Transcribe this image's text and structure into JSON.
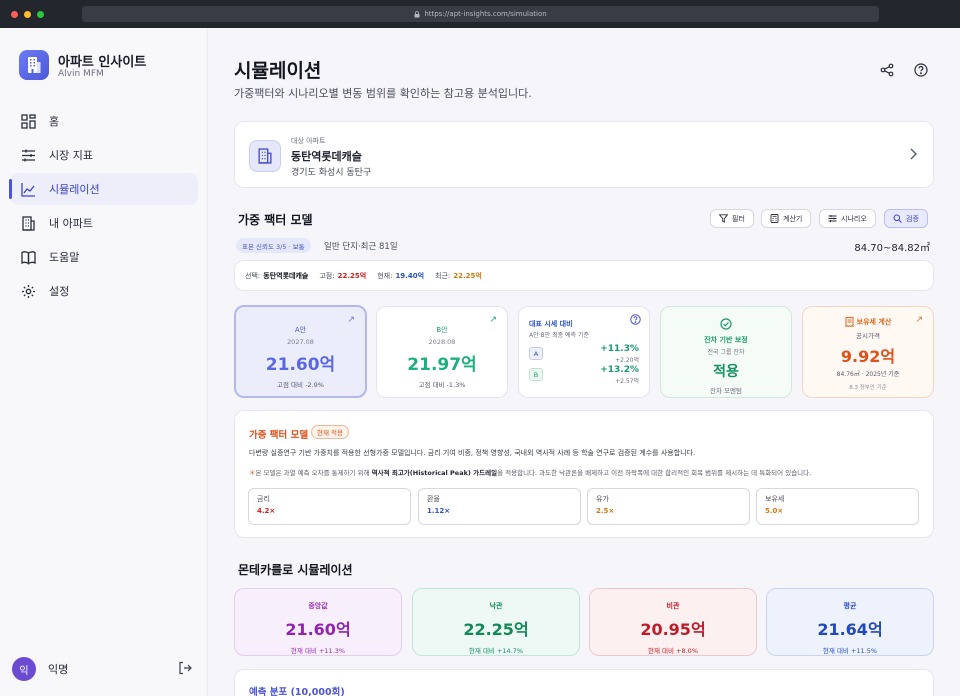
{
  "browser": {
    "url": "https://apt-insights.com/simulation"
  },
  "app": {
    "name": "아파트 인사이트",
    "user_sub": "Alvin MFM"
  },
  "nav": [
    {
      "label": "홈",
      "icon": "grid-icon"
    },
    {
      "label": "시장 지표",
      "icon": "sliders-icon"
    },
    {
      "label": "시뮬레이션",
      "icon": "chart-line-icon",
      "active": true
    },
    {
      "label": "내 아파트",
      "icon": "building-icon"
    },
    {
      "label": "도움말",
      "icon": "book-icon"
    },
    {
      "label": "설정",
      "icon": "gear-icon"
    }
  ],
  "user": {
    "initial": "익",
    "name": "익명"
  },
  "page": {
    "title": "시뮬레이션",
    "subtitle": "가중팩터와 시나리오별 변동 범위를 확인하는 참고용 분석입니다."
  },
  "target": {
    "label": "대상 아파트",
    "name": "동탄역롯데캐슬",
    "address": "경기도 화성시 동탄구"
  },
  "factor_model": {
    "title": "가중 팩터 모델",
    "buttons": [
      "필터",
      "계산기",
      "시나리오",
      "검증"
    ],
    "pill": "표본 신뢰도 3/5 · 보통",
    "desc": "일반 단지·최근 81일",
    "area": "84.70~84.82㎡",
    "sel_label": "선택:",
    "sel_name": "동탄역롯데캐슬",
    "fixed_label": "고점:",
    "fixed_value": "22.25억",
    "cur_label": "현재:",
    "cur_value": "19.40억",
    "recent_label": "최근:",
    "recent_value": "22.25억"
  },
  "scenarios": {
    "a": {
      "title": "A안",
      "date": "2027.08",
      "value": "21.60억",
      "change": "고점 대비 -2.9%"
    },
    "b": {
      "title": "B안",
      "date": "2028.08",
      "value": "21.97억",
      "change": "고점 대비 -1.3%"
    },
    "compare": {
      "title": "대표 시세 대비",
      "sub": "A안·B안 최종 예측 기준",
      "a_tag": "A",
      "a_pct": "+11.3%",
      "a_amt": "+2.20억",
      "b_tag": "B",
      "b_pct": "+13.2%",
      "b_amt": "+2.57억"
    },
    "correction": {
      "title": "잔차 기반 보정",
      "sub": "전국 그룹 잔차",
      "value": "적용",
      "note": "잔차 모멘텀"
    },
    "tax": {
      "title": "보유세 계산",
      "sub": "공시가격",
      "value": "9.92억",
      "note": "84.76㎡ · 2025년 기준",
      "foot": "8.3 정부안 기준"
    }
  },
  "model_detail": {
    "title": "가중 팩터 모델",
    "badge": "현재 적용",
    "desc": "다변량 실증연구 기반 가중치를 적용한 선형가중 모델입니다. 금리 기여 비중, 정책 영향성, 국내외 역사적 사례 등 학술 연구로 검증된 계수를 사용합니다.",
    "note_pre": "본 모델은 과열 예측 오차를 통제하기 위해",
    "note_bold": "역사적 최고가(Historical Peak) 가드레일",
    "note_post": "을 적용합니다. 과도한 낙관론을 배제하고 이전 하락폭에 대한 합리적인 회복 범위를 제시하는 데 특화되어 있습니다.",
    "factors": [
      {
        "label": "금리",
        "value": "4.2×",
        "color": "#d02020"
      },
      {
        "label": "환율",
        "value": "1.12×",
        "color": "#2a52c8"
      },
      {
        "label": "유가",
        "value": "2.5×",
        "color": "#d27a10"
      },
      {
        "label": "보유세",
        "value": "5.0×",
        "color": "#d27a10"
      }
    ]
  },
  "monte_carlo": {
    "title": "몬테카를로 시뮬레이션",
    "cards": [
      {
        "title": "중앙값",
        "value": "21.60억",
        "change": "현재 대비 +11.3%"
      },
      {
        "title": "낙관",
        "value": "22.25억",
        "change": "현재 대비 +14.7%"
      },
      {
        "title": "비관",
        "value": "20.95억",
        "change": "현재 대비 +8.0%"
      },
      {
        "title": "평균",
        "value": "21.64억",
        "change": "현재 대비 +11.5%"
      }
    ]
  },
  "distribution": {
    "title": "예측 분포 (10,000회)"
  }
}
